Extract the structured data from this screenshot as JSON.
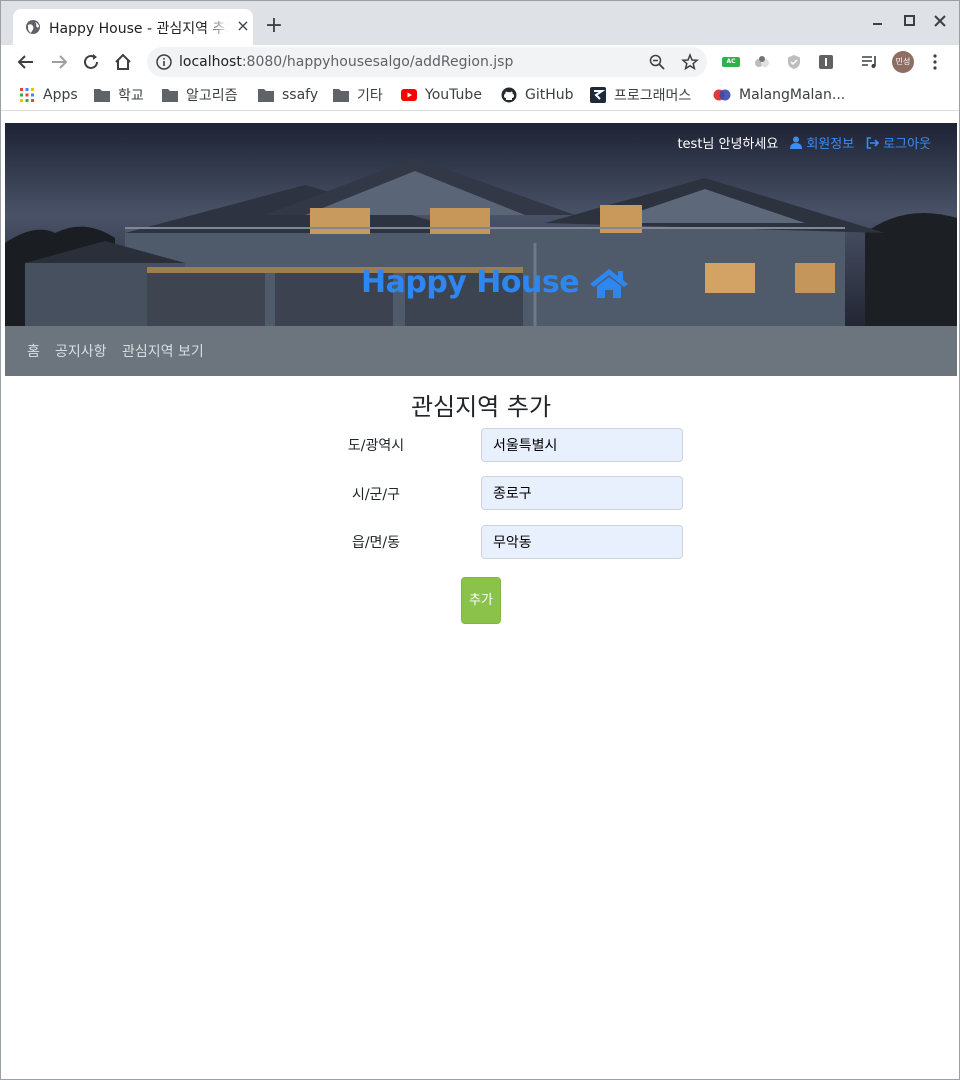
{
  "browser": {
    "tab_title": "Happy House - 관심지역 추가",
    "tab_close": "×",
    "new_tab": "+",
    "url_host": "localhost",
    "url_rest": ":8080/happyhousesalgo/addRegion.jsp",
    "avatar_text": "민성",
    "extension_ac_label": "AC"
  },
  "bookmarks": [
    {
      "label": "Apps",
      "icon": "apps-grid-icon"
    },
    {
      "label": "학교",
      "icon": "folder-icon"
    },
    {
      "label": "알고리즘",
      "icon": "folder-icon"
    },
    {
      "label": "ssafy",
      "icon": "folder-icon"
    },
    {
      "label": "기타",
      "icon": "folder-icon"
    },
    {
      "label": "YouTube",
      "icon": "youtube-icon"
    },
    {
      "label": "GitHub",
      "icon": "github-icon"
    },
    {
      "label": "프로그래머스",
      "icon": "programmers-icon"
    },
    {
      "label": "MalangMalan...",
      "icon": "malang-icon"
    }
  ],
  "header": {
    "greeting": "test님 안녕하세요",
    "member_info": "회원정보",
    "logout": "로그아웃",
    "brand": "Happy House"
  },
  "nav": {
    "home": "홈",
    "notice": "공지사항",
    "region_view": "관심지역 보기"
  },
  "form": {
    "title": "관심지역 추가",
    "fields": [
      {
        "label": "도/광역시",
        "value": "서울특별시"
      },
      {
        "label": "시/군/구",
        "value": "종로구"
      },
      {
        "label": "읍/면/동",
        "value": "무악동"
      }
    ],
    "submit": "추가"
  },
  "colors": {
    "brand": "#2e86f0",
    "navbar": "#6c757d",
    "submit": "#8bc34a",
    "link": "#3b8cf5"
  }
}
